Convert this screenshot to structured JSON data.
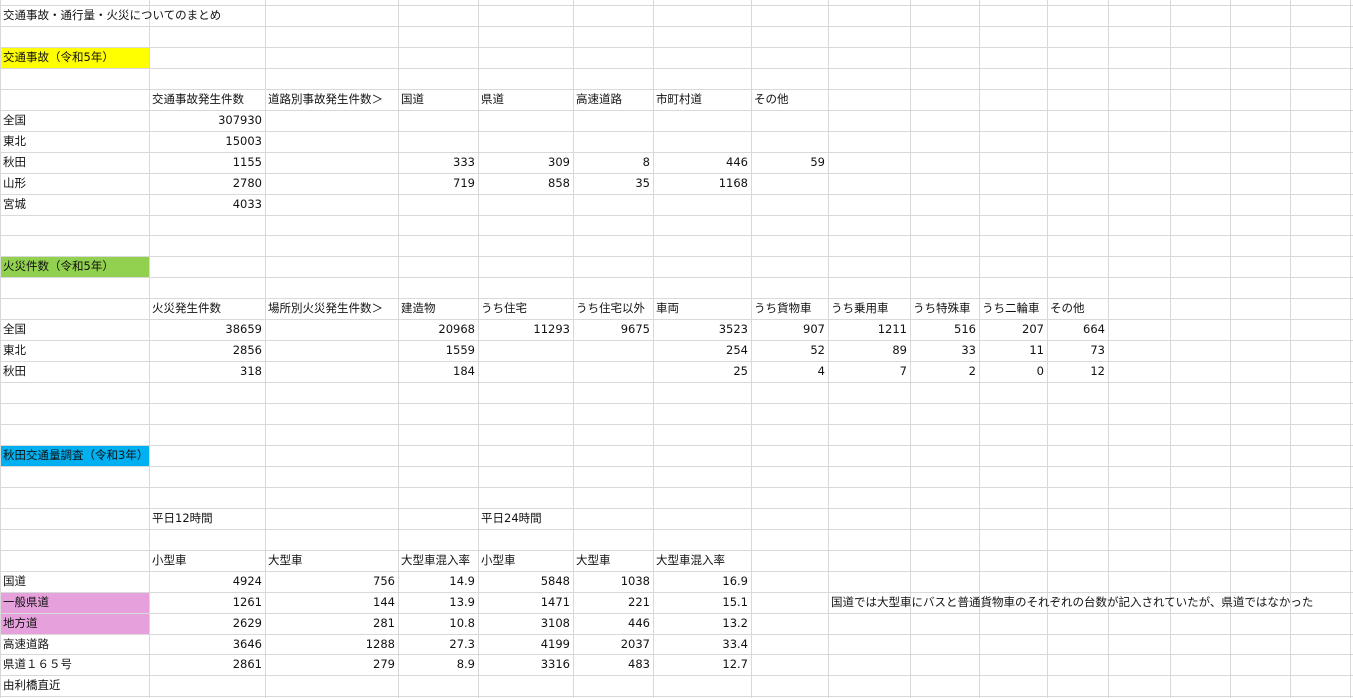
{
  "sheet": {
    "title": "交通事故・通行量・火災についてのまとめ",
    "colors": {
      "grid": "#d9d9d9",
      "yellow": "#ffff00",
      "green": "#92d050",
      "blue": "#00b0f0",
      "pink": "#e6a0dc"
    },
    "traffic_accidents": {
      "heading": "交通事故（令和5年）",
      "headers": [
        "交通事故発生件数",
        "道路別事故発生件数＞",
        "国道",
        "県道",
        "高速道路",
        "市町村道",
        "その他"
      ],
      "rows": [
        {
          "region": "全国",
          "total": "307930",
          "kokudo": "",
          "kendo": "",
          "kosoku": "",
          "shichoson": "",
          "other": ""
        },
        {
          "region": "東北",
          "total": "15003",
          "kokudo": "",
          "kendo": "",
          "kosoku": "",
          "shichoson": "",
          "other": ""
        },
        {
          "region": "秋田",
          "total": "1155",
          "kokudo": "333",
          "kendo": "309",
          "kosoku": "8",
          "shichoson": "446",
          "other": "59"
        },
        {
          "region": "山形",
          "total": "2780",
          "kokudo": "719",
          "kendo": "858",
          "kosoku": "35",
          "shichoson": "1168",
          "other": ""
        },
        {
          "region": "宮城",
          "total": "4033",
          "kokudo": "",
          "kendo": "",
          "kosoku": "",
          "shichoson": "",
          "other": ""
        }
      ]
    },
    "fires": {
      "heading": "火災件数（令和5年）",
      "headers": [
        "火災発生件数",
        "場所別火災発生件数＞",
        "建造物",
        "うち住宅",
        "うち住宅以外",
        "車両",
        "うち貨物車",
        "うち乗用車",
        "うち特殊車",
        "うち二輪車",
        "その他"
      ],
      "rows": [
        {
          "region": "全国",
          "total": "38659",
          "building": "20968",
          "house": "11293",
          "non_house": "9675",
          "vehicle": "3523",
          "cargo": "907",
          "passenger": "1211",
          "special": "516",
          "twowheel": "207",
          "other": "664"
        },
        {
          "region": "東北",
          "total": "2856",
          "building": "1559",
          "house": "",
          "non_house": "",
          "vehicle": "254",
          "cargo": "52",
          "passenger": "89",
          "special": "33",
          "twowheel": "11",
          "other": "73"
        },
        {
          "region": "秋田",
          "total": "318",
          "building": "184",
          "house": "",
          "non_house": "",
          "vehicle": "25",
          "cargo": "4",
          "passenger": "7",
          "special": "2",
          "twowheel": "0",
          "other": "12"
        }
      ]
    },
    "traffic_volume": {
      "heading": "秋田交通量調査（令和3年）",
      "period_12h": "平日12時間",
      "period_24h": "平日24時間",
      "headers": [
        "小型車",
        "大型車",
        "大型車混入率",
        "小型車",
        "大型車",
        "大型車混入率"
      ],
      "rows": [
        {
          "road": "国道",
          "small12": "4924",
          "large12": "756",
          "ratio12": "14.9",
          "small24": "5848",
          "large24": "1038",
          "ratio24": "16.9"
        },
        {
          "road": "一般県道",
          "small12": "1261",
          "large12": "144",
          "ratio12": "13.9",
          "small24": "1471",
          "large24": "221",
          "ratio24": "15.1"
        },
        {
          "road": "地方道",
          "small12": "2629",
          "large12": "281",
          "ratio12": "10.8",
          "small24": "3108",
          "large24": "446",
          "ratio24": "13.2"
        },
        {
          "road": "高速道路",
          "small12": "3646",
          "large12": "1288",
          "ratio12": "27.3",
          "small24": "4199",
          "large24": "2037",
          "ratio24": "33.4"
        },
        {
          "road": "県道１６５号",
          "small12": "2861",
          "large12": "279",
          "ratio12": "8.9",
          "small24": "3316",
          "large24": "483",
          "ratio24": "12.7"
        },
        {
          "road": "由利橋直近",
          "small12": "",
          "large12": "",
          "ratio12": "",
          "small24": "",
          "large24": "",
          "ratio24": ""
        }
      ],
      "note": "国道では大型車にバスと普通貨物車のそれぞれの台数が記入されていたが、県道ではなかった"
    }
  }
}
